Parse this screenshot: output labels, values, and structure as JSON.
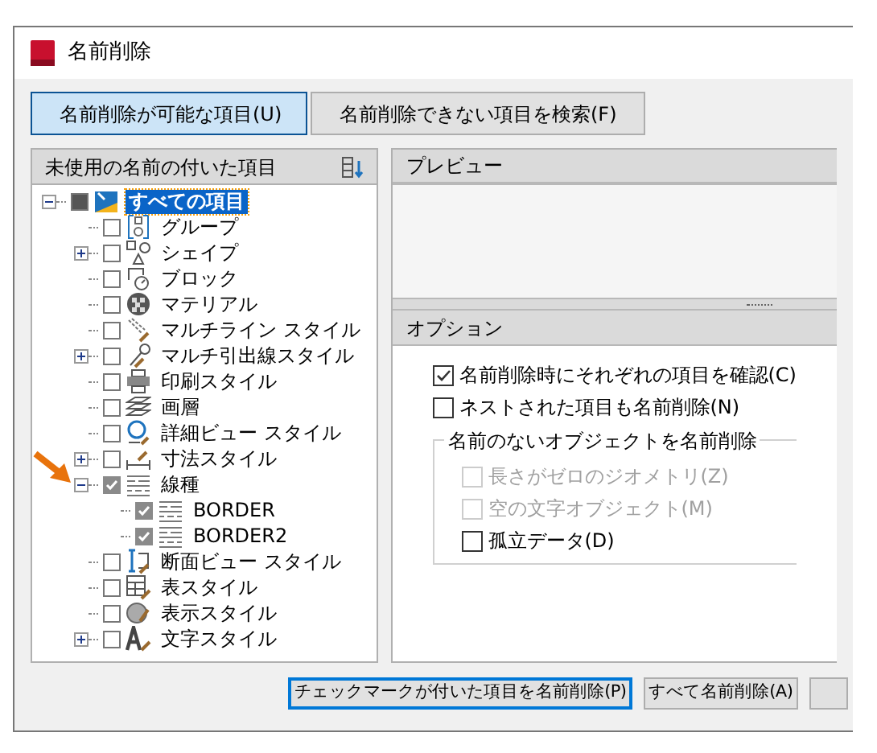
{
  "window": {
    "title": "名前削除"
  },
  "tabs": [
    {
      "label": "名前削除が可能な項目(U)",
      "selected": true
    },
    {
      "label": "名前削除できない項目を検索(F)",
      "selected": false
    }
  ],
  "tree": {
    "header": "未使用の名前の付いた項目",
    "items": [
      {
        "label": "すべての項目",
        "indeterminate": true,
        "expanded": true,
        "selected": true,
        "children": [
          {
            "label": "グループ",
            "checked": false,
            "selected": false
          },
          {
            "label": "シェイプ",
            "checked": false,
            "expanded": false,
            "selected": false
          },
          {
            "label": "ブロック",
            "checked": false,
            "selected": false
          },
          {
            "label": "マテリアル",
            "checked": false,
            "selected": false
          },
          {
            "label": "マルチライン スタイル",
            "checked": false,
            "selected": false
          },
          {
            "label": "マルチ引出線スタイル",
            "checked": false,
            "expanded": false,
            "selected": false
          },
          {
            "label": "印刷スタイル",
            "checked": false,
            "selected": false
          },
          {
            "label": "画層",
            "checked": false,
            "selected": false
          },
          {
            "label": "詳細ビュー スタイル",
            "checked": false,
            "selected": false
          },
          {
            "label": "寸法スタイル",
            "checked": false,
            "expanded": false,
            "selected": false
          },
          {
            "label": "線種",
            "checked": true,
            "expanded": true,
            "selected": false,
            "children": [
              {
                "label": "BORDER",
                "checked": true,
                "selected": false
              },
              {
                "label": "BORDER2",
                "checked": true,
                "selected": false
              }
            ]
          },
          {
            "label": "断面ビュー スタイル",
            "checked": false,
            "selected": false
          },
          {
            "label": "表スタイル",
            "checked": false,
            "selected": false
          },
          {
            "label": "表示スタイル",
            "checked": false,
            "selected": false
          },
          {
            "label": "文字スタイル",
            "checked": false,
            "expanded": false,
            "selected": false
          }
        ]
      }
    ]
  },
  "preview": {
    "header": "プレビュー"
  },
  "options": {
    "header": "オプション",
    "items": [
      {
        "label": "名前削除時にそれぞれの項目を確認(C)",
        "checked": true,
        "disabled": false
      },
      {
        "label": "ネストされた項目も名前削除(N)",
        "checked": false,
        "disabled": false
      }
    ],
    "group": {
      "label": "名前のないオブジェクトを名前削除",
      "items": [
        {
          "label": "長さがゼロのジオメトリ(Z)",
          "checked": false,
          "disabled": true
        },
        {
          "label": "空の文字オブジェクト(M)",
          "checked": false,
          "disabled": true
        },
        {
          "label": "孤立データ(D)",
          "checked": false,
          "disabled": false
        }
      ]
    }
  },
  "buttons": [
    {
      "label": "チェックマークが付いた項目を名前削除(P)",
      "focused": true
    },
    {
      "label": "すべて名前削除(A)",
      "focused": false
    },
    {
      "focused": false
    }
  ]
}
